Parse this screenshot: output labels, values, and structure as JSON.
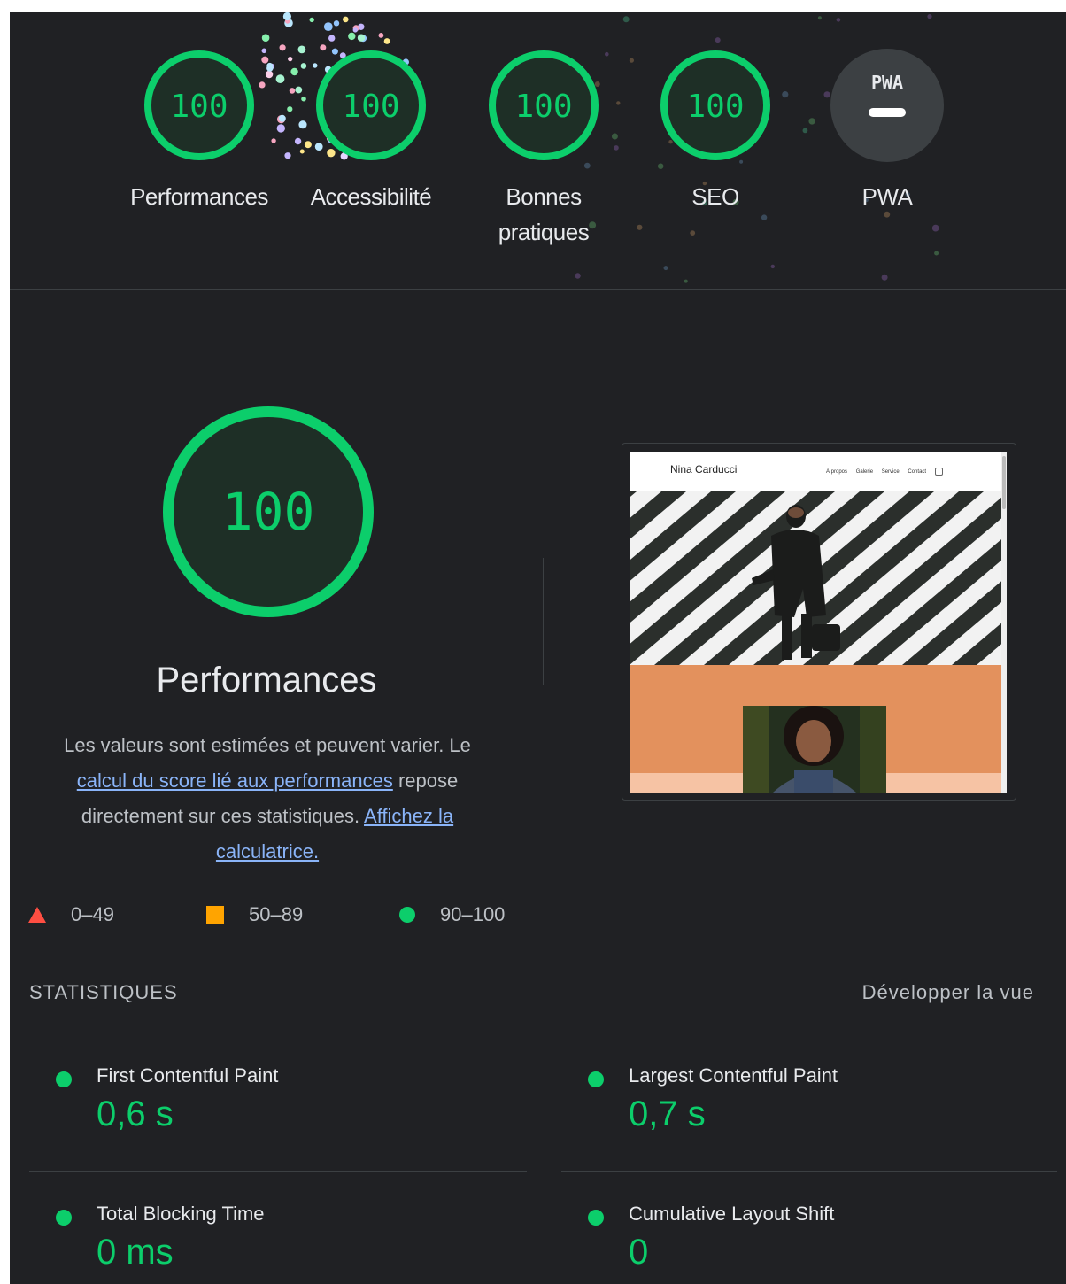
{
  "top_scores": [
    {
      "score": "100",
      "label": "Performances"
    },
    {
      "score": "100",
      "label": "Accessibilité"
    },
    {
      "score": "100",
      "label_line1": "Bonnes",
      "label_line2": "pratiques"
    },
    {
      "score": "100",
      "label": "SEO"
    },
    {
      "badge": "PWA",
      "label": "PWA"
    }
  ],
  "performance": {
    "score": "100",
    "title": "Performances",
    "desc_part1": "Les valeurs sont estimées et peuvent varier. Le ",
    "desc_link1": "calcul du score lié aux performances",
    "desc_part2": " repose directement sur ces statistiques. ",
    "desc_link2": "Affichez la calculatrice."
  },
  "screenshot": {
    "brand": "Nina Carducci",
    "nav": [
      "À propos",
      "Galerie",
      "Service",
      "Contact"
    ]
  },
  "legend": {
    "fail": "0–49",
    "average": "50–89",
    "pass": "90–100"
  },
  "metrics": {
    "header": "STATISTIQUES",
    "expand": "Développer la vue",
    "items": [
      {
        "label": "First Contentful Paint",
        "value": "0,6 s"
      },
      {
        "label": "Largest Contentful Paint",
        "value": "0,7 s"
      },
      {
        "label": "Total Blocking Time",
        "value": "0 ms"
      },
      {
        "label": "Cumulative Layout Shift",
        "value": "0"
      }
    ]
  },
  "colors": {
    "pass": "#0cce6b",
    "average": "#ffa400",
    "fail": "#ff4e42",
    "link": "#8ab4f8",
    "background": "#202124"
  }
}
